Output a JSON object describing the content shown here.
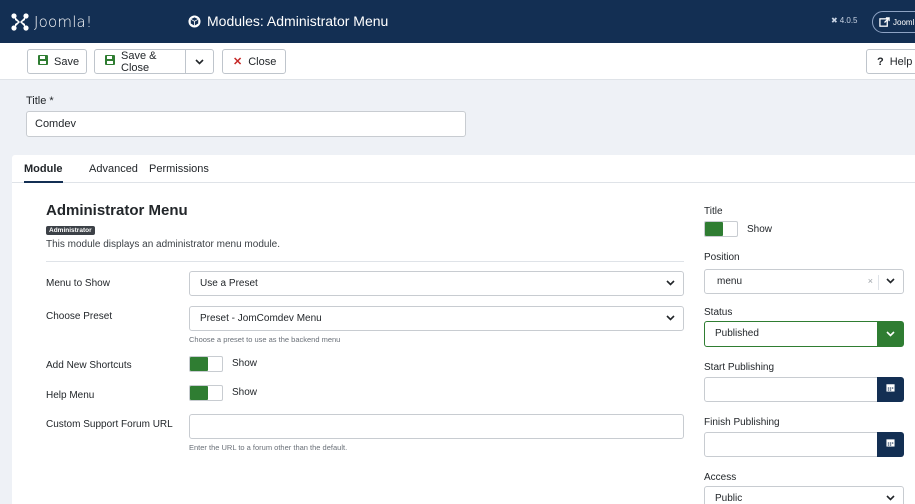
{
  "header": {
    "logo_text": "Joomla!",
    "title": "Modules: Administrator Menu",
    "version": "4.0.5",
    "view_site_label": "Jooml"
  },
  "toolbar": {
    "save_label": "Save",
    "save_close_label": "Save & Close",
    "close_label": "Close",
    "help_label": "Help"
  },
  "title_field": {
    "label": "Title *",
    "value": "Comdev"
  },
  "tabs": [
    {
      "label": "Module",
      "active": true
    },
    {
      "label": "Advanced",
      "active": false
    },
    {
      "label": "Permissions",
      "active": false
    }
  ],
  "module": {
    "heading": "Administrator Menu",
    "badge": "Administrator",
    "description": "This module displays an administrator menu module."
  },
  "fields": {
    "menu_to_show": {
      "label": "Menu to Show",
      "value": "Use a Preset"
    },
    "choose_preset": {
      "label": "Choose Preset",
      "value": "Preset - JomComdev Menu",
      "hint": "Choose a preset to use as the backend menu"
    },
    "add_new_shortcuts": {
      "label": "Add New Shortcuts",
      "toggle": "Show"
    },
    "help_menu": {
      "label": "Help Menu",
      "toggle": "Show"
    },
    "custom_support_url": {
      "label": "Custom Support Forum URL",
      "value": "",
      "hint": "Enter the URL to a forum other than the default."
    }
  },
  "sidebar": {
    "title_label": "Title",
    "title_toggle": "Show",
    "position_label": "Position",
    "position_value": "menu",
    "position_clear": "×",
    "status_label": "Status",
    "status_value": "Published",
    "start_publishing_label": "Start Publishing",
    "finish_publishing_label": "Finish Publishing",
    "access_label": "Access",
    "access_value": "Public"
  },
  "colors": {
    "header_bg": "#132f53",
    "accent_green": "#2f7d32",
    "danger": "#c52827"
  },
  "icons": [
    "joomla-logo-icon",
    "cube-icon",
    "joomla-small-icon",
    "external-link-icon",
    "save-icon",
    "chevron-down-icon",
    "close-icon",
    "help-icon",
    "calendar-icon"
  ]
}
